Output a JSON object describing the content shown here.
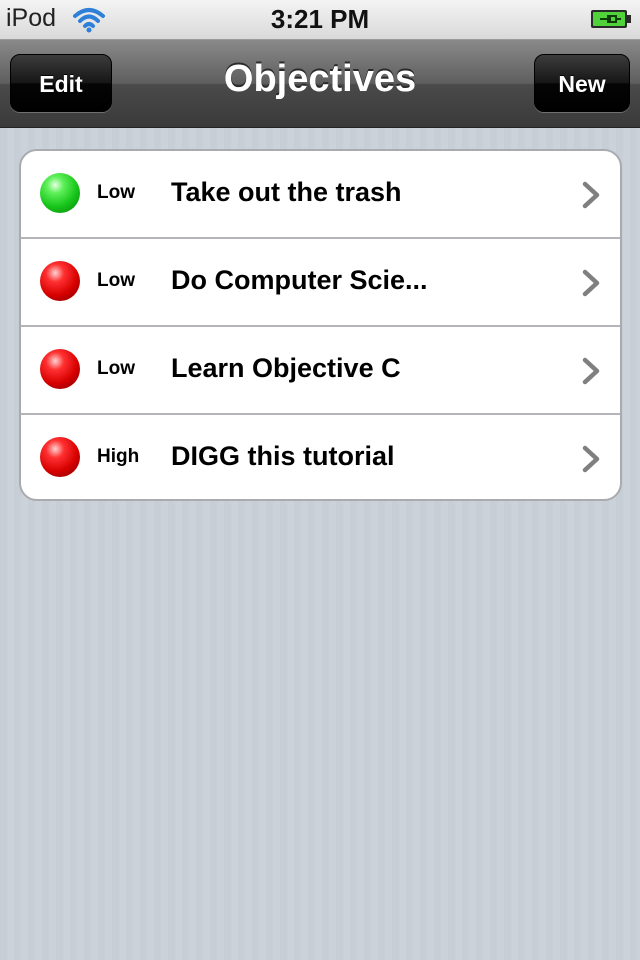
{
  "status_bar": {
    "carrier": "iPod",
    "time": "3:21 PM",
    "wifi_icon": "wifi-icon",
    "battery_icon": "battery-charging-icon"
  },
  "nav_bar": {
    "title": "Objectives",
    "left_button": "Edit",
    "right_button": "New"
  },
  "objectives": [
    {
      "status_color": "#22c922",
      "status_icon": "green-status-ball-icon",
      "priority": "Low",
      "title": "Take out the trash"
    },
    {
      "status_color": "#e00000",
      "status_icon": "red-status-ball-icon",
      "priority": "Low",
      "title": "Do Computer Scie..."
    },
    {
      "status_color": "#e00000",
      "status_icon": "red-status-ball-icon",
      "priority": "Low",
      "title": "Learn Objective C"
    },
    {
      "status_color": "#e00000",
      "status_icon": "red-status-ball-icon",
      "priority": "High",
      "title": "DIGG this tutorial"
    }
  ],
  "disclosure_icon": "chevron-right-icon"
}
